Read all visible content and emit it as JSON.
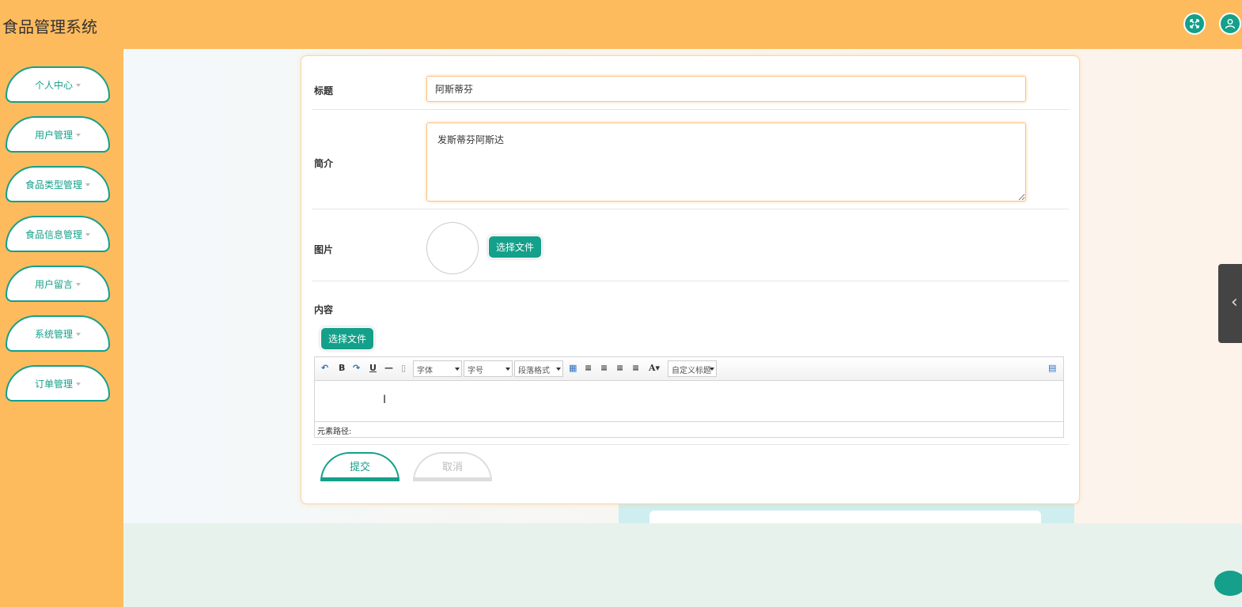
{
  "app": {
    "title": "食品管理系统"
  },
  "header": {
    "fullscreen_icon": "fullscreen-icon",
    "user_icon": "user-icon"
  },
  "sidebar": {
    "items": [
      {
        "label": "个人中心"
      },
      {
        "label": "用户管理"
      },
      {
        "label": "食品类型管理"
      },
      {
        "label": "食品信息管理"
      },
      {
        "label": "用户留言"
      },
      {
        "label": "系统管理"
      },
      {
        "label": "订单管理"
      }
    ]
  },
  "form": {
    "title_label": "标题",
    "title_value": "阿斯蒂芬",
    "intro_label": "简介",
    "intro_value": "发斯蒂芬阿斯达",
    "image_label": "图片",
    "choose_file": "选择文件",
    "content_label": "内容",
    "content_choose_file": "选择文件",
    "submit_label": "提交",
    "cancel_label": "取消"
  },
  "editor": {
    "font_family": "字体",
    "font_size": "字号",
    "paragraph": "段落格式",
    "custom_title": "自定义标题",
    "path_label": "元素路径:"
  },
  "colors": {
    "accent": "#14a08a",
    "header": "#fdbb5e"
  }
}
